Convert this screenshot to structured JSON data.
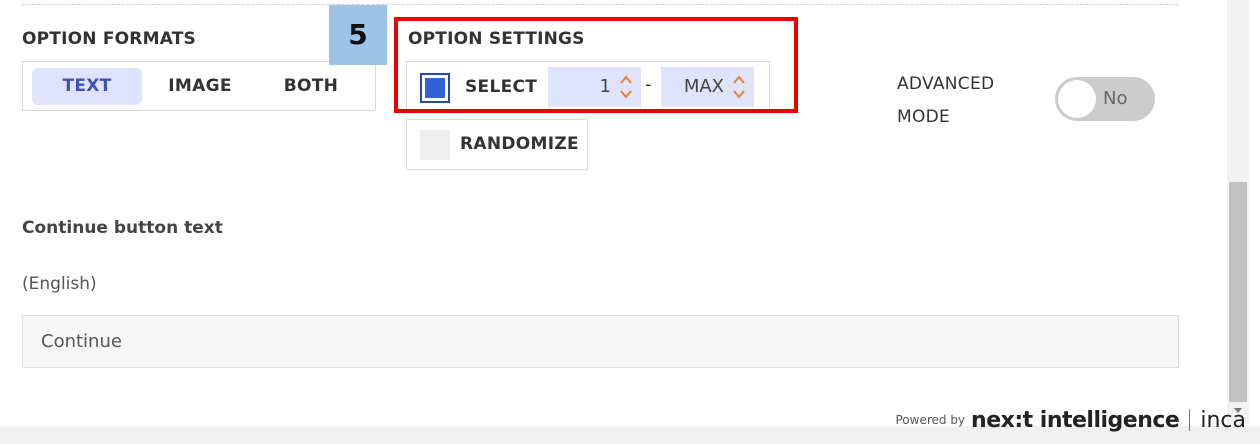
{
  "option_formats": {
    "title": "OPTION FORMATS",
    "buttons": [
      "TEXT",
      "IMAGE",
      "BOTH"
    ],
    "active": "TEXT"
  },
  "step_badge": "5",
  "option_settings": {
    "title": "OPTION SETTINGS",
    "select_label": "SELECT",
    "select_checked": true,
    "min_value": "1",
    "separator": "-",
    "max_value": "MAX",
    "randomize_label": "RANDOMIZE",
    "randomize_checked": false
  },
  "advanced_mode": {
    "label_line1": "ADVANCED",
    "label_line2": "MODE",
    "toggle_label": "No"
  },
  "continue_button": {
    "label": "Continue button text",
    "language": "(English)",
    "value": "Continue"
  },
  "footer": {
    "powered_by": "Powered by",
    "brand": "nex:t intelligence",
    "brand2": "inca"
  },
  "colors": {
    "active_tab_bg": "#dfe3fb",
    "active_tab_text": "#3f51b5",
    "checkbox_fill": "#2f63d6",
    "spinner_arrows": "#e8832a",
    "highlight_frame": "#ee0000",
    "badge_bg": "#9dc3e6"
  }
}
